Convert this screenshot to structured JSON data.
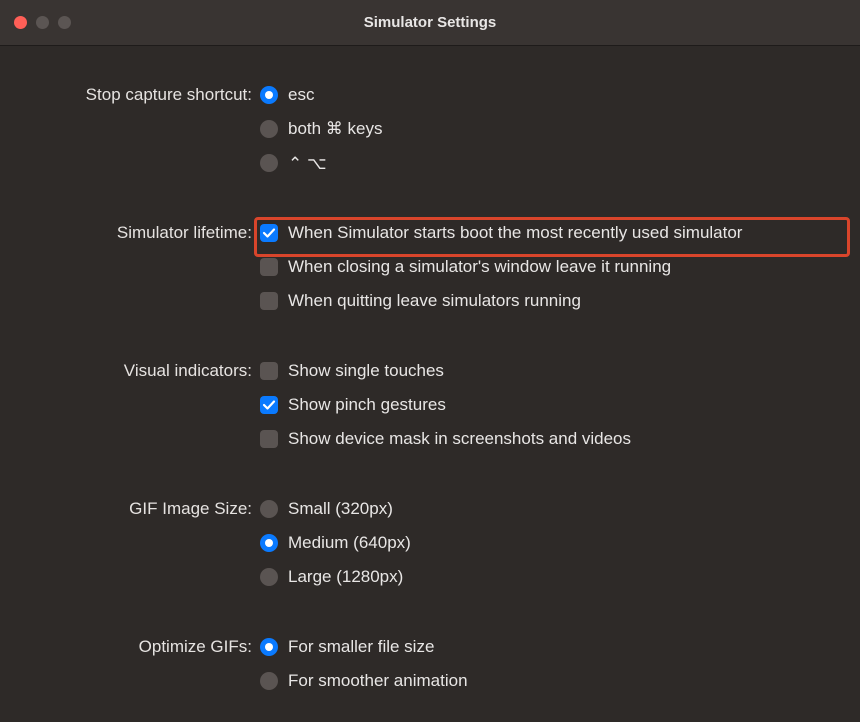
{
  "window": {
    "title": "Simulator Settings"
  },
  "sections": {
    "stopCapture": {
      "label": "Stop capture shortcut:",
      "options": [
        {
          "label": "esc",
          "selected": true
        },
        {
          "label": "both ⌘ keys",
          "selected": false
        },
        {
          "label": "⌃  ⌥",
          "selected": false
        }
      ]
    },
    "simulatorLifetime": {
      "label": "Simulator lifetime:",
      "options": [
        {
          "label": "When Simulator starts boot the most recently used simulator",
          "checked": true,
          "highlighted": true
        },
        {
          "label": "When closing a simulator's window leave it running",
          "checked": false
        },
        {
          "label": "When quitting leave simulators running",
          "checked": false
        }
      ]
    },
    "visualIndicators": {
      "label": "Visual indicators:",
      "options": [
        {
          "label": "Show single touches",
          "checked": false
        },
        {
          "label": "Show pinch gestures",
          "checked": true
        },
        {
          "label": "Show device mask in screenshots and videos",
          "checked": false
        }
      ]
    },
    "gifImageSize": {
      "label": "GIF Image Size:",
      "options": [
        {
          "label": "Small (320px)",
          "selected": false
        },
        {
          "label": "Medium (640px)",
          "selected": true
        },
        {
          "label": "Large (1280px)",
          "selected": false
        }
      ]
    },
    "optimizeGIFs": {
      "label": "Optimize GIFs:",
      "options": [
        {
          "label": "For smaller file size",
          "selected": true
        },
        {
          "label": "For smoother animation",
          "selected": false
        }
      ]
    }
  }
}
